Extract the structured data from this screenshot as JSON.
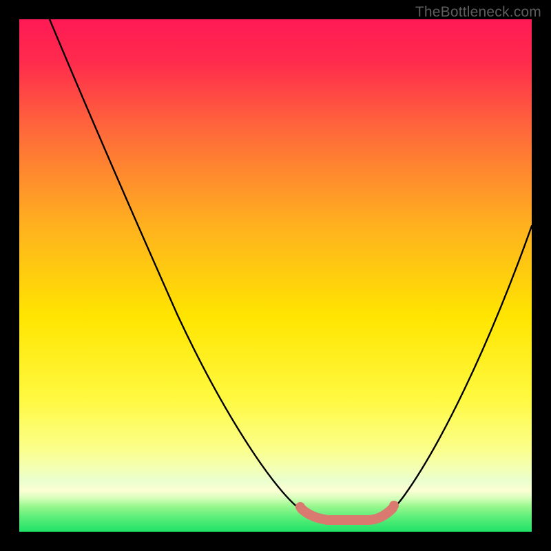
{
  "attribution": "TheBottleneck.com",
  "colors": {
    "frame": "#000000",
    "gradient_top": "#ff1a4d",
    "gradient_mid1": "#ff7a2a",
    "gradient_mid2": "#ffd200",
    "gradient_mid3": "#fff95a",
    "gradient_band_light": "#f6ffb0",
    "gradient_bottom": "#2ee86b",
    "curve": "#000000",
    "accent_segment": "#d9796f"
  },
  "chart_data": {
    "type": "line",
    "title": "",
    "xlabel": "",
    "ylabel": "",
    "xlim": [
      0,
      100
    ],
    "ylim": [
      0,
      100
    ],
    "series": [
      {
        "name": "bottleneck-curve",
        "x": [
          6,
          10,
          15,
          20,
          25,
          30,
          35,
          40,
          45,
          50,
          55,
          58,
          60,
          62,
          65,
          68,
          70,
          75,
          80,
          85,
          90,
          95,
          100
        ],
        "y": [
          100,
          92,
          83,
          74,
          65,
          56,
          47,
          38,
          29,
          20,
          11,
          5,
          2,
          0,
          0,
          0,
          2,
          8,
          17,
          28,
          40,
          52,
          64
        ]
      }
    ],
    "annotations": [
      {
        "name": "highlight-trough",
        "type": "segment",
        "x_range": [
          55,
          72
        ],
        "y_approx": 0
      }
    ]
  }
}
